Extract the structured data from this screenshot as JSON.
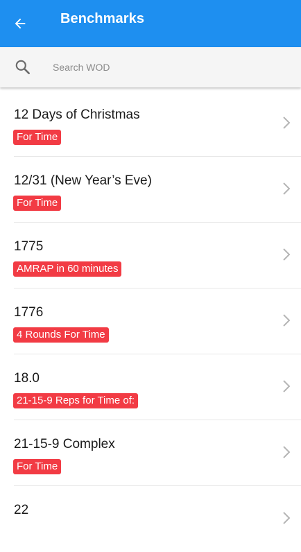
{
  "appbar": {
    "title": "Benchmarks",
    "color": "#1e8ff0",
    "back_icon": "arrow-left-icon"
  },
  "search": {
    "placeholder": "Search WOD",
    "value": "",
    "icon": "search-icon"
  },
  "badge_color": "#f23b44",
  "workouts": [
    {
      "name": "12 Days of Christmas",
      "type": "For Time"
    },
    {
      "name": "12/31 (New Year’s Eve)",
      "type": "For Time"
    },
    {
      "name": "1775",
      "type": "AMRAP in 60 minutes"
    },
    {
      "name": "1776",
      "type": "4 Rounds For Time"
    },
    {
      "name": "18.0",
      "type": "21-15-9 Reps for Time of:"
    },
    {
      "name": "21-15-9 Complex",
      "type": "For Time"
    },
    {
      "name": "22",
      "type": ""
    }
  ]
}
